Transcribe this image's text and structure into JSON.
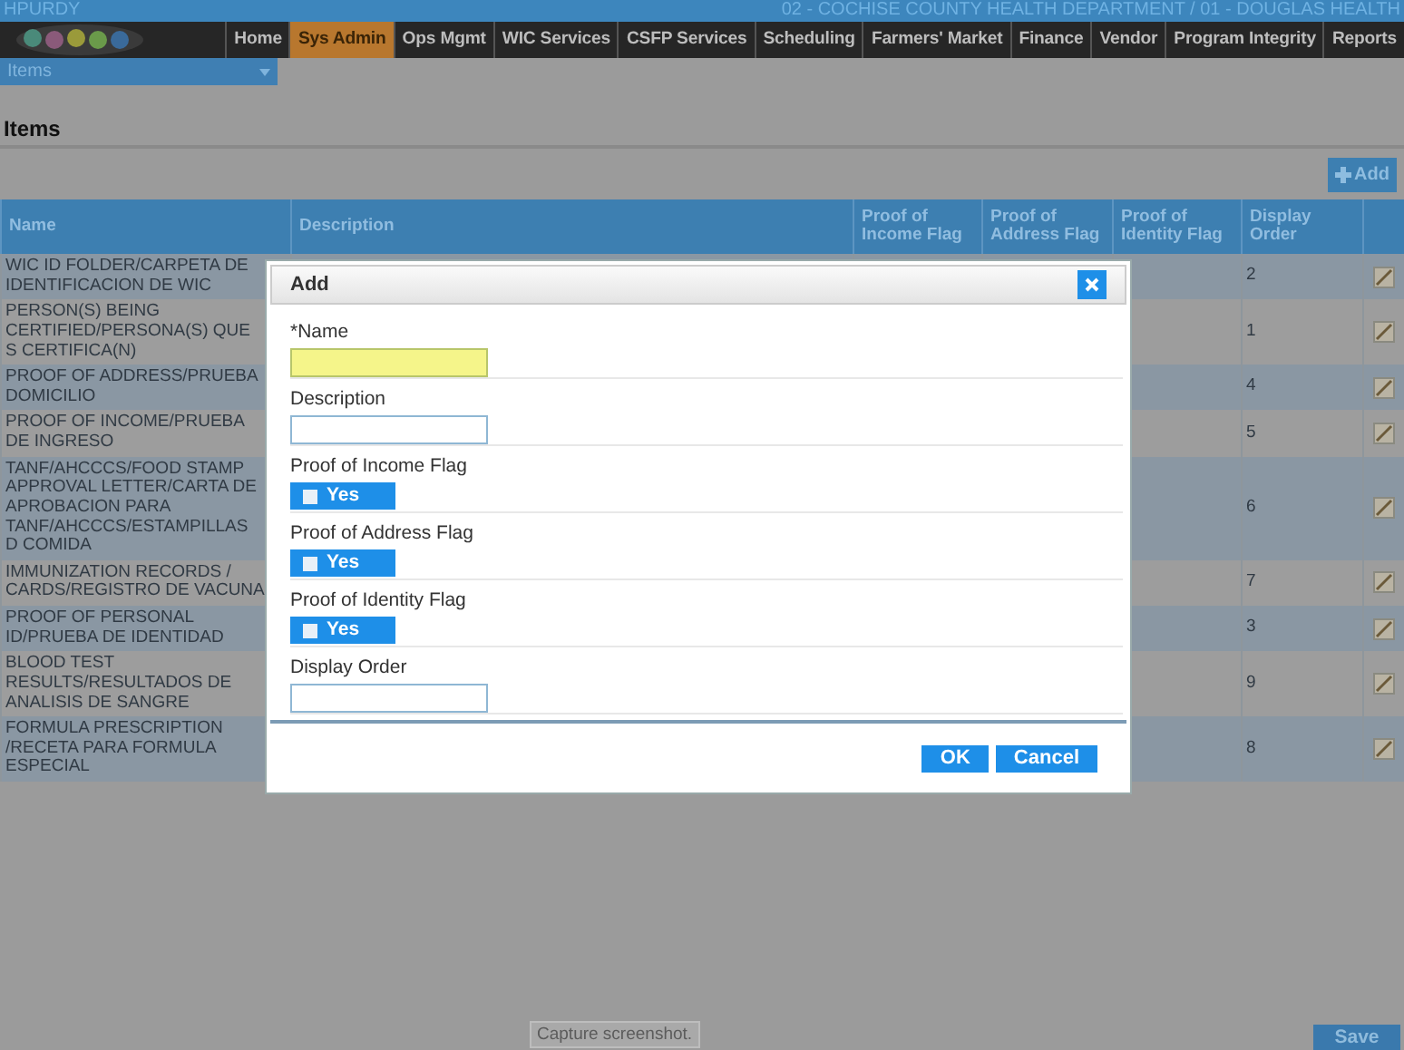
{
  "top_bar": {
    "user": "HPURDY",
    "agency": "02 - COCHISE COUNTY HEALTH DEPARTMENT / 01 - DOUGLAS HEALTH"
  },
  "nav_tabs": [
    {
      "label": "Home",
      "selected": false
    },
    {
      "label": "Sys Admin",
      "selected": true
    },
    {
      "label": "Ops Mgmt",
      "selected": false
    },
    {
      "label": "WIC Services",
      "selected": false
    },
    {
      "label": "CSFP Services",
      "selected": false
    },
    {
      "label": "Scheduling",
      "selected": false
    },
    {
      "label": "Farmers' Market",
      "selected": false
    },
    {
      "label": "Finance",
      "selected": false
    },
    {
      "label": "Vendor",
      "selected": false
    },
    {
      "label": "Program Integrity",
      "selected": false
    },
    {
      "label": "Reports",
      "selected": false
    }
  ],
  "page_selector": {
    "value": "Items"
  },
  "page_title": "Items",
  "add_button": "Add",
  "table": {
    "columns": [
      "Name",
      "Description",
      "Proof of Income Flag",
      "Proof of Address Flag",
      "Proof of Identity Flag",
      "Display Order"
    ],
    "rows": [
      {
        "name": "WIC ID FOLDER/CARPETA DE IDENTIFICACION DE WIC",
        "display_order": "2"
      },
      {
        "name": "PERSON(S) BEING CERTIFIED/PERSONA(S) QUE S CERTIFICA(N)",
        "display_order": "1"
      },
      {
        "name": "PROOF OF ADDRESS/PRUEBA DOMICILIO",
        "display_order": "4"
      },
      {
        "name": "PROOF OF INCOME/PRUEBA DE INGRESO",
        "display_order": "5"
      },
      {
        "name": "TANF/AHCCCS/FOOD STAMP APPROVAL LETTER/CARTA DE APROBACION PARA TANF/AHCCCS/ESTAMPILLAS D COMIDA",
        "display_order": "6"
      },
      {
        "name": "IMMUNIZATION RECORDS / CARDS/REGISTRO DE VACUNA",
        "display_order": "7"
      },
      {
        "name": "PROOF OF PERSONAL ID/PRUEBA DE IDENTIDAD",
        "display_order": "3"
      },
      {
        "name": "BLOOD TEST RESULTS/RESULTADOS DE ANALISIS DE SANGRE",
        "display_order": "9"
      },
      {
        "name": "FORMULA PRESCRIPTION /RECETA PARA FORMULA ESPECIAL",
        "display_order": "8"
      }
    ]
  },
  "dialog": {
    "title": "Add",
    "fields": [
      {
        "kind": "text",
        "label": "*Name",
        "required": true
      },
      {
        "kind": "text",
        "label": "Description",
        "required": false
      },
      {
        "kind": "toggle",
        "label": "Proof of Income Flag",
        "option": "Yes",
        "checked": false
      },
      {
        "kind": "toggle",
        "label": "Proof of Address Flag",
        "option": "Yes",
        "checked": false
      },
      {
        "kind": "toggle",
        "label": "Proof of Identity Flag",
        "option": "Yes",
        "checked": false
      },
      {
        "kind": "text",
        "label": "Display Order",
        "required": false
      }
    ],
    "buttons": [
      "OK",
      "Cancel"
    ]
  },
  "tooltip": "Capture screenshot.",
  "save_button": "Save"
}
